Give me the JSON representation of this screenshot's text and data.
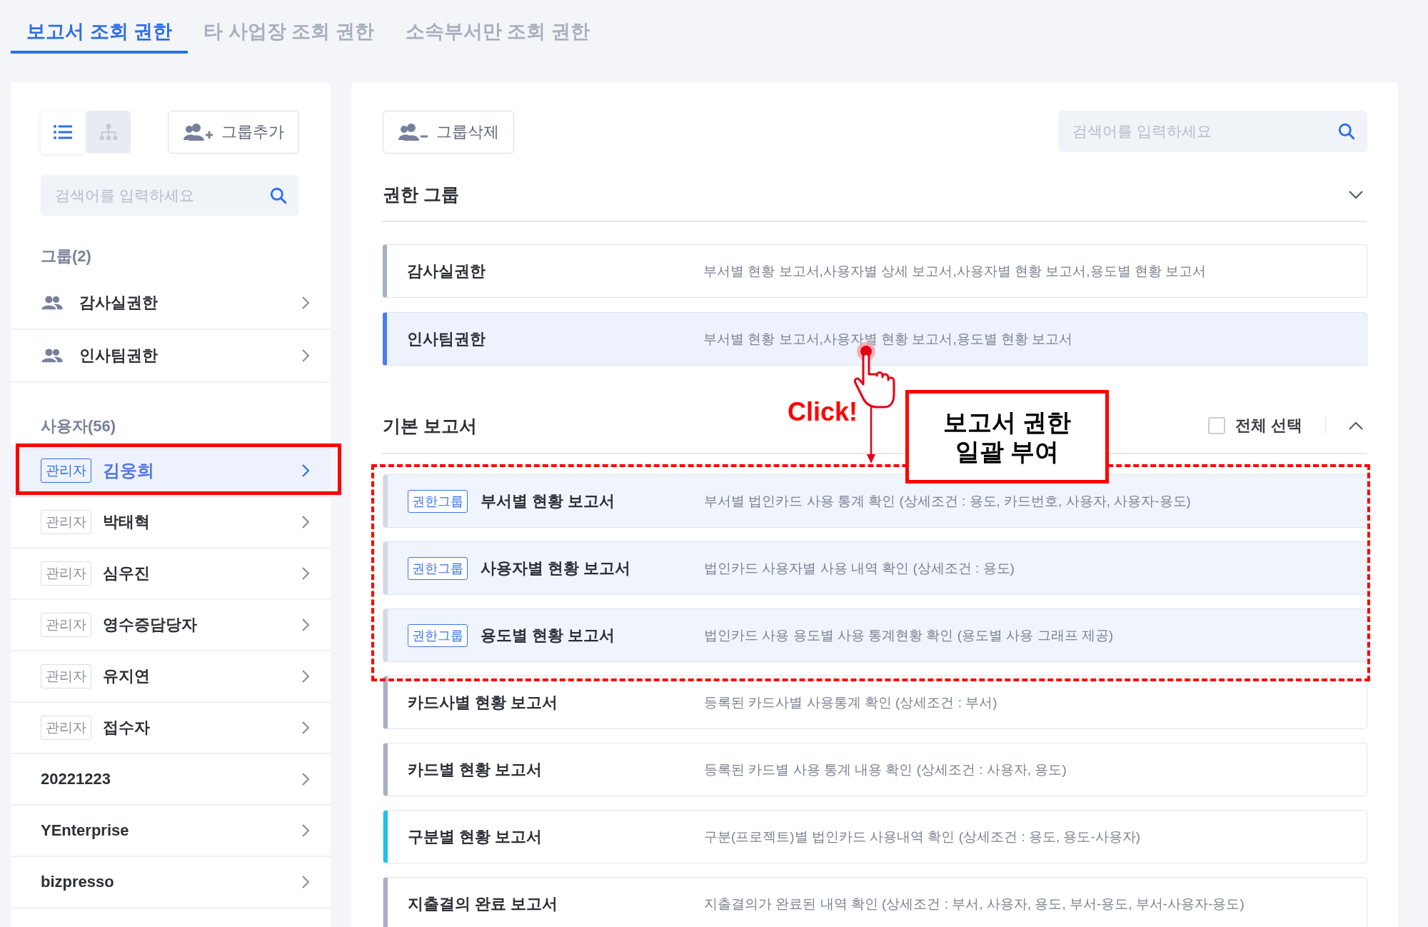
{
  "tabs": [
    {
      "label": "보고서 조회 권한",
      "selected": true
    },
    {
      "label": "타 사업장 조회 권한",
      "selected": false
    },
    {
      "label": "소속부서만 조회 권한",
      "selected": false
    }
  ],
  "sidebar": {
    "view_modes": [
      {
        "kind": "list",
        "selected": true
      },
      {
        "kind": "tree",
        "selected": false
      }
    ],
    "add_button": "그룹추가",
    "search": {
      "placeholder": "검색어를 입력하세요"
    },
    "groups_heading": "그룹(2)",
    "groups": [
      {
        "name": "감사실권한"
      },
      {
        "name": "인사팀권한"
      }
    ],
    "users_heading": "사용자(56)",
    "users": [
      {
        "badge": "관리자",
        "name": "김웅희",
        "selected": true
      },
      {
        "badge": "관리자",
        "name": "박태혁",
        "selected": false
      },
      {
        "badge": "관리자",
        "name": "심우진",
        "selected": false
      },
      {
        "badge": "관리자",
        "name": "영수증담당자",
        "selected": false
      },
      {
        "badge": "관리자",
        "name": "유지연",
        "selected": false
      },
      {
        "badge": "관리자",
        "name": "접수자",
        "selected": false
      },
      {
        "name": "20221223",
        "selected": false
      },
      {
        "name": "YEnterprise",
        "selected": false
      },
      {
        "name": "bizpresso",
        "selected": false
      }
    ]
  },
  "main": {
    "delete_button": "그룹삭제",
    "search": {
      "placeholder": "검색어를 입력하세요"
    },
    "group_section": {
      "title": "권한 그룹",
      "expanded": false,
      "items": [
        {
          "name": "감사실권한",
          "reports": "부서별 현황 보고서,사용자별 상세 보고서,사용자별 현황 보고서,용도별 현황 보고서",
          "selected": false
        },
        {
          "name": "인사팀권한",
          "reports": "부서별 현황 보고서,사용자별 현황 보고서,용도별 현황 보고서",
          "selected": true
        }
      ]
    },
    "report_section": {
      "title": "기본 보고서",
      "expanded": true,
      "select_all": {
        "label": "전체 선택",
        "checked": false
      },
      "items": [
        {
          "badge": "권한그룹",
          "name": "부서별 현황 보고서",
          "description": "부서별 법인카드 사용 통계 확인 (상세조건 : 용도, 카드번호, 사용자, 사용자-용도)",
          "highlighted": true,
          "color": "#d3d9e6"
        },
        {
          "badge": "권한그룹",
          "name": "사용자별 현황 보고서",
          "description": "법인카드 사용자별 사용 내역 확인 (상세조건 : 용도)",
          "highlighted": true,
          "color": "#d3d9e6"
        },
        {
          "badge": "권한그룹",
          "name": "용도별 현황 보고서",
          "description": "법인카드 사용 용도별 사용 통계현황 확인 (용도별 사용 그래프 제공)",
          "highlighted": true,
          "color": "#d3d9e6"
        },
        {
          "name": "카드사별 현황 보고서",
          "description": "등록된 카드사별 사용통계 확인 (상세조건 : 부서)",
          "highlighted": false,
          "color": "#a9b0c4"
        },
        {
          "name": "카드별 현황 보고서",
          "description": "등록된 카드별 사용 통계 내용 확인 (상세조건 : 사용자, 용도)",
          "highlighted": false,
          "color": "#a9b0c4"
        },
        {
          "name": "구분별 현황 보고서",
          "description": "구분(프로젝트)별 법인카드 사용내역 확인 (상세조건 : 용도, 용도-사용자)",
          "highlighted": false,
          "color": "#1cc3ee"
        },
        {
          "name": "지출결의 완료 보고서",
          "description": "지출결의가 완료된 내역 확인 (상세조건 : 부서, 사용자, 용도, 부서-용도, 부서-사용자-용도)",
          "highlighted": false,
          "color": "#a9b0c4"
        }
      ]
    }
  },
  "annotations": [
    {
      "kind": "row-highlight"
    },
    {
      "kind": "dashed-region"
    },
    {
      "kind": "hand-cursor"
    },
    {
      "kind": "arrow"
    },
    {
      "kind": "click-label",
      "text": "Click!"
    },
    {
      "kind": "callout",
      "lines": [
        "보고서 권한",
        "일괄 부여"
      ]
    }
  ]
}
